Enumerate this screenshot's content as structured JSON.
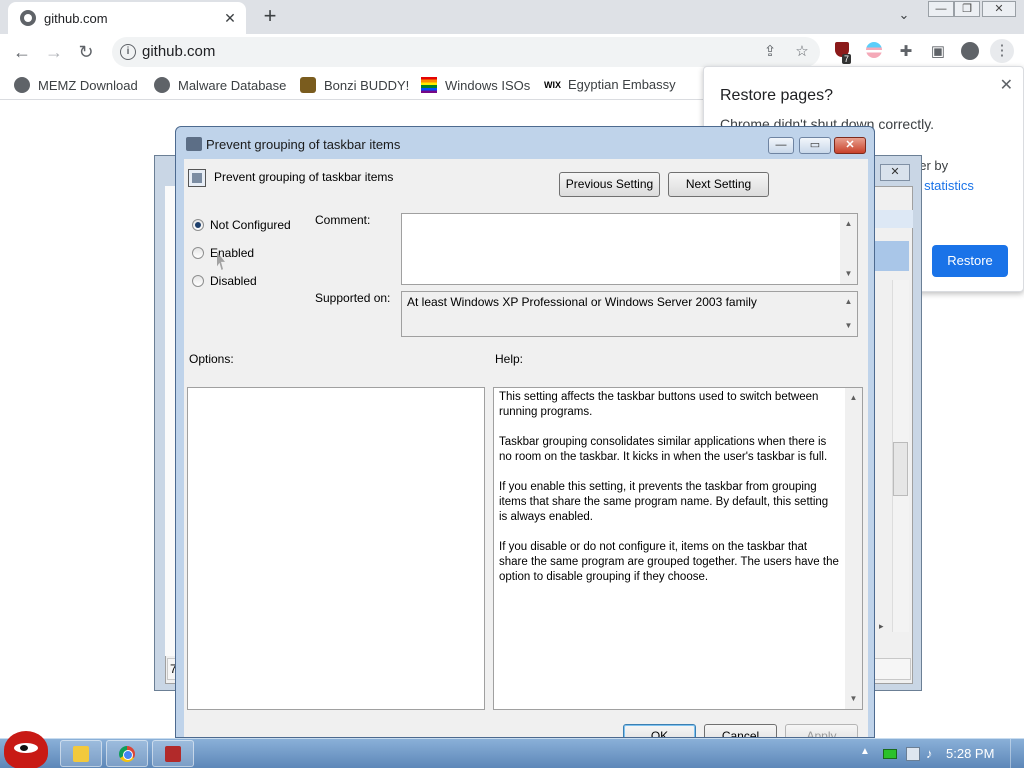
{
  "browser": {
    "tab_title": "github.com",
    "url": "github.com",
    "bookmarks": [
      "MEMZ Download",
      "Malware Database",
      "Bonzi BUDDY!",
      "Windows ISOs",
      "Egyptian Embassy"
    ],
    "extension_badge": "7"
  },
  "restore_bubble": {
    "title": "Restore pages?",
    "message": "Chrome didn't shut down correctly.",
    "hidden_fragment_1": "tter by",
    "hidden_fragment_2": "ge statistics",
    "restore_button": "Restore"
  },
  "background_window": {
    "status_fragment": "7"
  },
  "dialog": {
    "title": "Prevent grouping of taskbar items",
    "policy_name": "Prevent grouping of taskbar items",
    "prev_button": "Previous Setting",
    "next_button": "Next Setting",
    "radio_not_configured": "Not Configured",
    "radio_enabled": "Enabled",
    "radio_disabled": "Disabled",
    "selected_state": "Not Configured",
    "comment_label": "Comment:",
    "supported_label": "Supported on:",
    "supported_value": "At least Windows XP Professional or Windows Server 2003 family",
    "options_label": "Options:",
    "help_label": "Help:",
    "help_paragraphs": [
      "This setting affects the taskbar buttons used to switch between running programs.",
      "Taskbar grouping consolidates similar applications when there is no room on the taskbar. It kicks in when the user's taskbar is full.",
      "If you enable this setting, it prevents the taskbar from grouping items that share the same program name. By default, this setting is always enabled.",
      "If you disable or do not configure it, items on the taskbar that share the same program are grouped together. The users have the option to disable grouping if they choose."
    ],
    "ok_button": "OK",
    "cancel_button": "Cancel",
    "apply_button": "Apply"
  },
  "taskbar": {
    "time": "5:28 PM"
  }
}
